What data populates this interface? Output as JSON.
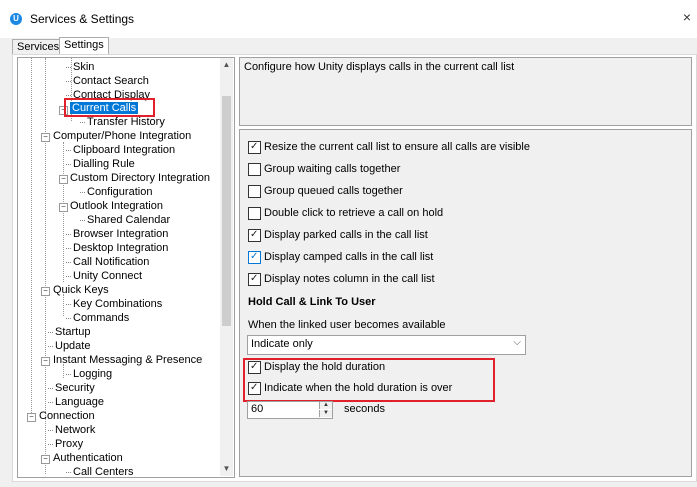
{
  "window": {
    "title": "Services & Settings",
    "close_glyph": "×",
    "app_icon_letter": "U"
  },
  "tabs": [
    {
      "label": "Services"
    },
    {
      "label": "Settings"
    }
  ],
  "tree": {
    "items": [
      {
        "label": "Skin"
      },
      {
        "label": "Contact Search"
      },
      {
        "label": "Contact Display"
      },
      {
        "label": "Current Calls"
      },
      {
        "label": "Transfer History"
      },
      {
        "label": "Computer/Phone Integration"
      },
      {
        "label": "Clipboard Integration"
      },
      {
        "label": "Dialling Rule"
      },
      {
        "label": "Custom Directory Integration"
      },
      {
        "label": "Configuration"
      },
      {
        "label": "Outlook Integration"
      },
      {
        "label": "Shared Calendar"
      },
      {
        "label": "Browser Integration"
      },
      {
        "label": "Desktop Integration"
      },
      {
        "label": "Call Notification"
      },
      {
        "label": "Unity Connect"
      },
      {
        "label": "Quick Keys"
      },
      {
        "label": "Key Combinations"
      },
      {
        "label": "Commands"
      },
      {
        "label": "Startup"
      },
      {
        "label": "Update"
      },
      {
        "label": "Instant Messaging & Presence"
      },
      {
        "label": "Logging"
      },
      {
        "label": "Security"
      },
      {
        "label": "Language"
      },
      {
        "label": "Connection"
      },
      {
        "label": "Network"
      },
      {
        "label": "Proxy"
      },
      {
        "label": "Authentication"
      },
      {
        "label": "Call Centers"
      }
    ],
    "selected": "Current Calls"
  },
  "description": "Configure how Unity displays calls in the current call list",
  "options": [
    {
      "label": "Resize the current call list to ensure all calls are visible",
      "checked": true
    },
    {
      "label": "Group waiting calls together",
      "checked": false
    },
    {
      "label": "Group queued calls together",
      "checked": false
    },
    {
      "label": "Double click to retrieve a call on hold",
      "checked": false
    },
    {
      "label": "Display parked calls in the call list",
      "checked": true
    },
    {
      "label": "Display camped calls in the call list",
      "checked": true
    },
    {
      "label": "Display notes column in the call list",
      "checked": true
    }
  ],
  "hold": {
    "heading": "Hold Call & Link To User",
    "subtext": "When the linked user becomes available",
    "select_value": "Indicate only",
    "display_duration": {
      "label": "Display the hold duration",
      "checked": true
    },
    "indicate_over": {
      "label": "Indicate when the hold duration is over",
      "checked": true
    },
    "duration_value": "60",
    "duration_unit": "seconds"
  },
  "colors": {
    "highlight_red": "#e0202a",
    "selection_blue": "#0078d7"
  }
}
